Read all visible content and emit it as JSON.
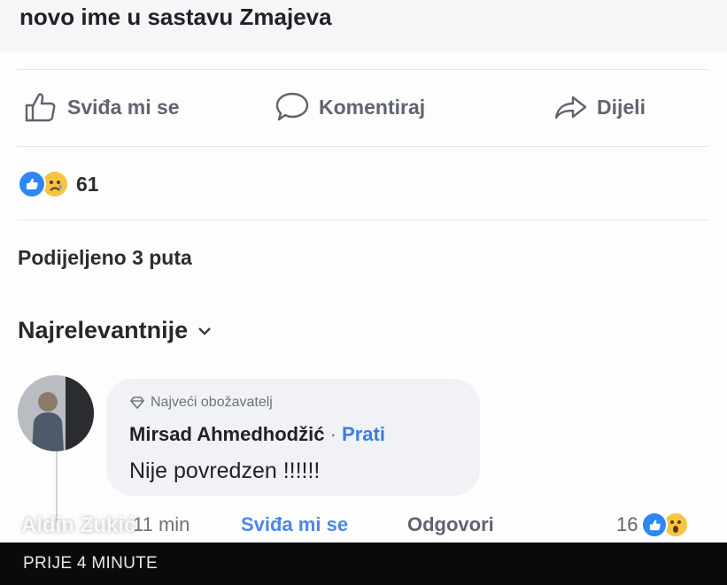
{
  "post": {
    "text": "novo ime u sastavu Zmajeva",
    "actions": {
      "like": "Sviđa mi se",
      "comment": "Komentiraj",
      "share": "Dijeli"
    },
    "reactions": {
      "count": "61",
      "types": [
        "like",
        "sad"
      ]
    },
    "shares": "Podijeljeno 3 puta"
  },
  "comments": {
    "sort_label": "Najrelevantnije",
    "items": [
      {
        "badge": "Najveći obožavatelj",
        "author": "Mirsad Ahmedhodžić",
        "separator": "·",
        "follow": "Prati",
        "text": "Nije povredzen !!!!!!",
        "time": "11 min",
        "like": "Sviđa mi se",
        "reply": "Odgovori",
        "reaction_count": "16",
        "reaction_types": [
          "like",
          "wow"
        ]
      }
    ]
  },
  "overlay": {
    "watermark": "Aldin Zukić",
    "timestamp": "PRIJE 4 MINUTE"
  }
}
